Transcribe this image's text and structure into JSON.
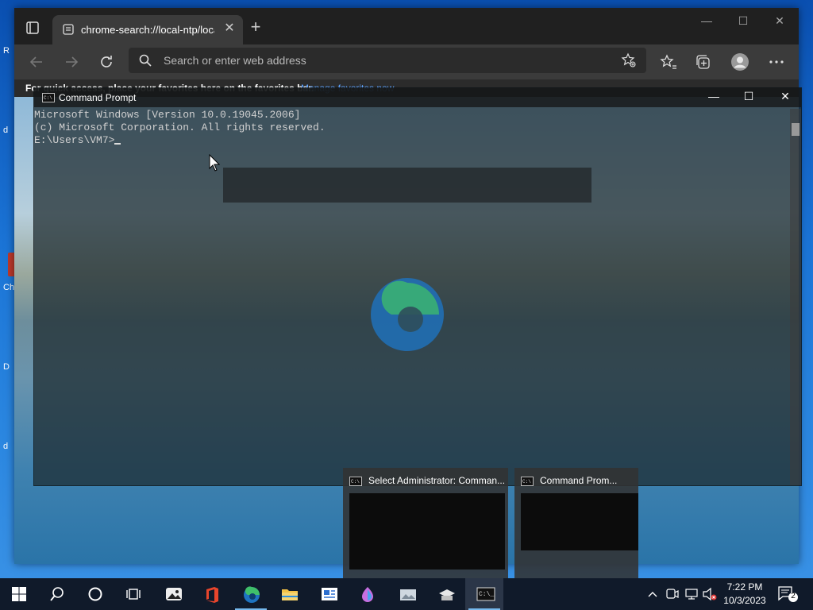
{
  "desktop": {
    "icon_labels": [
      "R",
      "d",
      "Ch",
      "D",
      "d"
    ]
  },
  "edge": {
    "tab": {
      "title": "chrome-search://local-ntp/local-ntp.html",
      "close_glyph": "✕"
    },
    "new_tab_glyph": "+",
    "window_controls": {
      "minimize": "—",
      "maximize": "☐",
      "close": "✕"
    },
    "address_bar": {
      "placeholder": "Search or enter web address"
    },
    "favorites_bar": {
      "message": "For quick access, place your favorites here on the favorites bar.",
      "link": "Manage favorites now"
    }
  },
  "cmd": {
    "title": "Command Prompt",
    "controls": {
      "minimize": "—",
      "maximize": "☐",
      "close": "✕"
    },
    "lines": [
      "Microsoft Windows [Version 10.0.19045.2006]",
      "(c) Microsoft Corporation. All rights reserved.",
      "",
      "E:\\Users\\VM7>"
    ]
  },
  "thumbnails": [
    {
      "title": "Select Administrator: Comman..."
    },
    {
      "title": "Command Prom..."
    }
  ],
  "taskbar": {
    "items": [
      "start",
      "search",
      "cortana",
      "task-view",
      "photos",
      "office",
      "edge",
      "file-explorer",
      "news",
      "paint-3d",
      "app-generic",
      "settings-hub",
      "command-prompt"
    ],
    "clock": {
      "time": "7:22 PM",
      "date": "10/3/2023"
    },
    "notification_count": "2"
  },
  "colors": {
    "taskbar_bg": "#101a2a",
    "link": "#5ea3ff",
    "cmd_text": "#d0d0d0"
  }
}
